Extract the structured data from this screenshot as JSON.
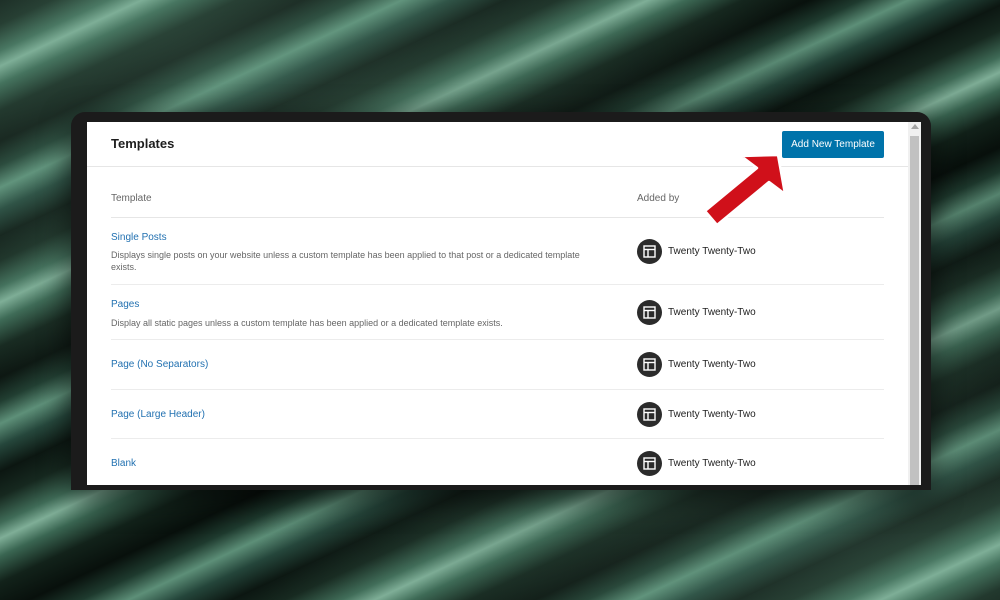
{
  "header": {
    "title": "Templates",
    "add_button_label": "Add New Template"
  },
  "table": {
    "columns": [
      "Template",
      "Added by"
    ],
    "rows": [
      {
        "title": "Single Posts",
        "description": "Displays single posts on your website unless a custom template has been applied to that post or a dedicated template exists.",
        "added_by": "Twenty Twenty-Two"
      },
      {
        "title": "Pages",
        "description": "Display all static pages unless a custom template has been applied or a dedicated template exists.",
        "added_by": "Twenty Twenty-Two"
      },
      {
        "title": "Page (No Separators)",
        "description": "",
        "added_by": "Twenty Twenty-Two"
      },
      {
        "title": "Page (Large Header)",
        "description": "",
        "added_by": "Twenty Twenty-Two"
      },
      {
        "title": "Blank",
        "description": "",
        "added_by": "Twenty Twenty-Two"
      }
    ]
  },
  "icons": {
    "theme_icon": "layout-template-icon",
    "callout": "red-arrow-icon"
  },
  "colors": {
    "primary_button": "#0073aa",
    "link": "#2271b1",
    "arrow": "#d0101a",
    "icon_bg": "#2b2b2b"
  }
}
